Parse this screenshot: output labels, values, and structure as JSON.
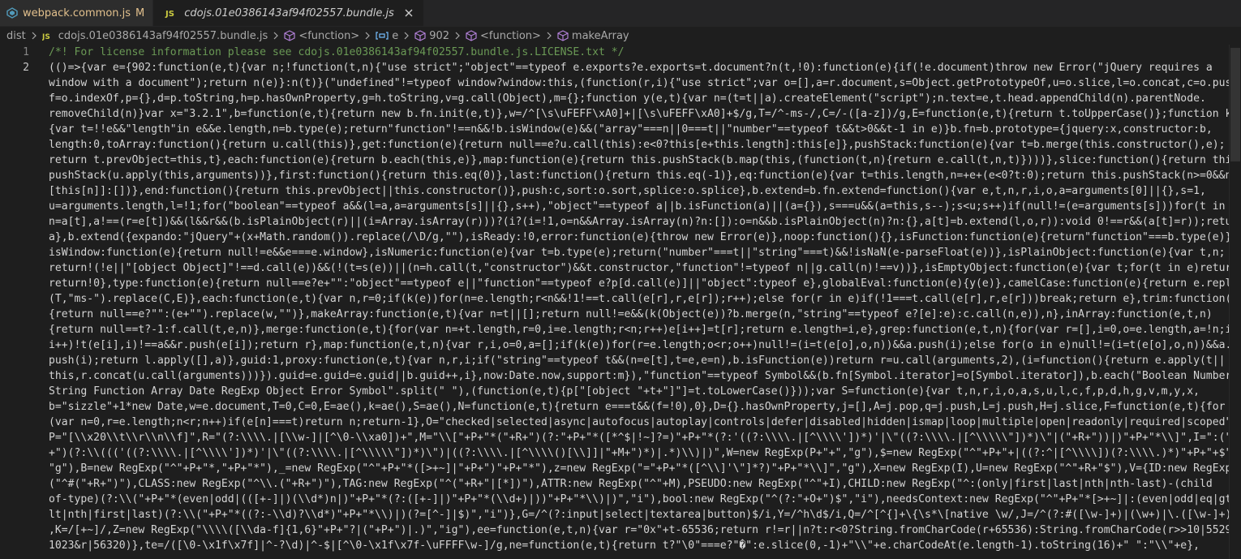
{
  "tabs": [
    {
      "label": "webpack.common.js",
      "badge": "M",
      "active": false
    },
    {
      "label": "cdojs.01e0386143af94f02557.bundle.js",
      "active": true
    }
  ],
  "breadcrumb": {
    "dist": "dist",
    "file": "cdojs.01e0386143af94f02557.bundle.js",
    "fn1": "<function>",
    "var": "e",
    "num": "902",
    "fn2": "<function>",
    "method": "makeArray"
  },
  "line_numbers": [
    "1",
    "2"
  ],
  "code_lines": [
    "/*! For license information please see cdojs.01e0386143af94f02557.bundle.js.LICENSE.txt */",
    "(()=>{var e={902:function(e,t){var n;!function(t,n){\"use strict\";\"object\"==typeof e.exports?e.exports=t.document?n(t,!0):function(e){if(!e.document)throw new Error(\"jQuery requires a",
    "window with a document\");return n(e)}:n(t)}(\"undefined\"!=typeof window?window:this,(function(r,i){\"use strict\";var o=[],a=r.document,s=Object.getPrototypeOf,u=o.slice,l=o.concat,c=o.push,",
    "f=o.indexOf,p={},d=p.toString,h=p.hasOwnProperty,g=h.toString,v=g.call(Object),m={};function y(e,t){var n=(t=t||a).createElement(\"script\");n.text=e,t.head.appendChild(n).parentNode.",
    "removeChild(n)}var x=\"3.2.1\",b=function(e,t){return new b.fn.init(e,t)},w=/^[\\s\\uFEFF\\xA0]+|[\\s\\uFEFF\\xA0]+$/g,T=/^-ms-/,C=/-([a-z])/g,E=function(e,t){return t.toUpperCase()};function k(e)",
    "{var t=!!e&&\"length\"in e&&e.length,n=b.type(e);return\"function\"!==n&&!b.isWindow(e)&&(\"array\"===n||0===t||\"number\"==typeof t&&t>0&&t-1 in e)}b.fn=b.prototype={jquery:x,constructor:b,",
    "length:0,toArray:function(){return u.call(this)},get:function(e){return null==e?u.call(this):e<0?this[e+this.length]:this[e]},pushStack:function(e){var t=b.merge(this.constructor(),e);",
    "return t.prevObject=this,t},each:function(e){return b.each(this,e)},map:function(e){return this.pushStack(b.map(this,(function(t,n){return e.call(t,n,t)})))},slice:function(){return this.",
    "pushStack(u.apply(this,arguments))},first:function(){return this.eq(0)},last:function(){return this.eq(-1)},eq:function(e){var t=this.length,n=+e+(e<0?t:0);return this.pushStack(n>=0&&n<t?",
    "[this[n]]:[])},end:function(){return this.prevObject||this.constructor()},push:c,sort:o.sort,splice:o.splice},b.extend=b.fn.extend=function(){var e,t,n,r,i,o,a=arguments[0]||{},s=1,",
    "u=arguments.length,l=!1;for(\"boolean\"==typeof a&&(l=a,a=arguments[s]||{},s++),\"object\"==typeof a||b.isFunction(a)||(a={}),s===u&&(a=this,s--);s<u;s++)if(null!=(e=arguments[s]))for(t in e)",
    "n=a[t],a!==(r=e[t])&&(l&&r&&(b.isPlainObject(r)||(i=Array.isArray(r)))?(i?(i=!1,o=n&&Array.isArray(n)?n:[]):o=n&&b.isPlainObject(n)?n:{},a[t]=b.extend(l,o,r)):void 0!==r&&(a[t]=r));return",
    "a},b.extend({expando:\"jQuery\"+(x+Math.random()).replace(/\\D/g,\"\"),isReady:!0,error:function(e){throw new Error(e)},noop:function(){},isFunction:function(e){return\"function\"===b.type(e)},",
    "isWindow:function(e){return null!=e&&e===e.window},isNumeric:function(e){var t=b.type(e);return(\"number\"===t||\"string\"===t)&&!isNaN(e-parseFloat(e))},isPlainObject:function(e){var t,n;",
    "return!(!e||\"[object Object]\"!==d.call(e))&&(!(t=s(e))||(n=h.call(t,\"constructor\")&&t.constructor,\"function\"!=typeof n||g.call(n)!==v))},isEmptyObject:function(e){var t;for(t in e)return!1;",
    "return!0},type:function(e){return null==e?e+\"\":\"object\"==typeof e||\"function\"==typeof e?p[d.call(e)]||\"object\":typeof e},globalEval:function(e){y(e)},camelCase:function(e){return e.replace",
    "(T,\"ms-\").replace(C,E)},each:function(e,t){var n,r=0;if(k(e))for(n=e.length;r<n&&!1!==t.call(e[r],r,e[r]);r++);else for(r in e)if(!1===t.call(e[r],r,e[r]))break;return e},trim:function(e)",
    "{return null==e?\"\":(e+\"\").replace(w,\"\")},makeArray:function(e,t){var n=t||[];return null!=e&&(k(Object(e))?b.merge(n,\"string\"==typeof e?[e]:e):c.call(n,e)),n},inArray:function(e,t,n)",
    "{return null==t?-1:f.call(t,e,n)},merge:function(e,t){for(var n=+t.length,r=0,i=e.length;r<n;r++)e[i++]=t[r];return e.length=i,e},grep:function(e,t,n){for(var r=[],i=0,o=e.length,a=!n;i<o;",
    "i++)!t(e[i],i)!==a&&r.push(e[i]);return r},map:function(e,t,n){var r,i,o=0,a=[];if(k(e))for(r=e.length;o<r;o++)null!=(i=t(e[o],o,n))&&a.push(i);else for(o in e)null!=(i=t(e[o],o,n))&&a.",
    "push(i);return l.apply([],a)},guid:1,proxy:function(e,t){var n,r,i;if(\"string\"==typeof t&&(n=e[t],t=e,e=n),b.isFunction(e))return r=u.call(arguments,2),(i=function(){return e.apply(t||",
    "this,r.concat(u.call(arguments)))}).guid=e.guid=e.guid||b.guid++,i},now:Date.now,support:m}),\"function\"==typeof Symbol&&(b.fn[Symbol.iterator]=o[Symbol.iterator]),b.each(\"Boolean Number",
    "String Function Array Date RegExp Object Error Symbol\".split(\" \"),(function(e,t){p[\"[object \"+t+\"]\"]=t.toLowerCase()}));var S=function(e){var t,n,r,i,o,a,s,u,l,c,f,p,d,h,g,v,m,y,x,",
    "b=\"sizzle\"+1*new Date,w=e.document,T=0,C=0,E=ae(),k=ae(),S=ae(),N=function(e,t){return e===t&&(f=!0),0},D={}.hasOwnProperty,j=[],A=j.pop,q=j.push,L=j.push,H=j.slice,F=function(e,t){for",
    "(var n=0,r=e.length;n<r;n++)if(e[n]===t)return n;return-1},O=\"checked|selected|async|autofocus|autoplay|controls|defer|disabled|hidden|ismap|loop|multiple|open|readonly|required|scoped\",",
    "P=\"[\\\\x20\\\\t\\\\r\\\\n\\\\f]\",R=\"(?:\\\\\\\\.|[\\\\w-]|[^\\0-\\\\xa0])+\",M=\"\\\\[\"+P+\"*(\"+R+\")(?:\"+P+\"*([*^$|!~]?=)\"+P+\"*(?:'((?:\\\\\\\\.|[^\\\\\\\\'])*)'|\\\"((?:\\\\\\\\.|[^\\\\\\\\\\\"])*)\\\"|(\"+R+\"))|)\"+P+\"*\\\\]\",I=\":(\"+R",
    "+\")(?:\\\\((('((?:\\\\\\\\.|[^\\\\\\\\'])*)'|\\\"((?:\\\\\\\\.|[^\\\\\\\\\\\"])*)\\\")|((?:\\\\\\\\.|[^\\\\\\\\()[\\\\]]|\"+M+\")*)|.*)\\\\)|)\",W=new RegExp(P+\"+\",\"g\"),$=new RegExp(\"^\"+P+\"+|((?:^|[^\\\\\\\\])(?:\\\\\\\\.)*)\"+P+\"+$\",",
    "\"g\"),B=new RegExp(\"^\"+P+\"*,\"+P+\"*\"),_=new RegExp(\"^\"+P+\"*([>+~]|\"+P+\")\"+P+\"*\"),z=new RegExp(\"=\"+P+\"*([^\\\\]'\\\"]*?)\"+P+\"*\\\\]\",\"g\"),X=new RegExp(I),U=new RegExp(\"^\"+R+\"$\"),V={ID:new RegExp",
    "(\"^#(\"+R+\")\"),CLASS:new RegExp(\"^\\\\.(\"+R+\")\"),TAG:new RegExp(\"^(\"+R+\"|[*])\"),ATTR:new RegExp(\"^\"+M),PSEUDO:new RegExp(\"^\"+I),CHILD:new RegExp(\"^:(only|first|last|nth|nth-last)-(child",
    "of-type)(?:\\\\(\"+P+\"*(even|odd|(([+-]|)(\\\\d*)n|)\"+P+\"*(?:([+-]|)\"+P+\"*(\\\\d+)|))\"+P+\"*\\\\)|)\",\"i\"),bool:new RegExp(\"^(?:\"+O+\")$\",\"i\"),needsContext:new RegExp(\"^\"+P+\"*[>+~]|:(even|odd|eq|gt|",
    "lt|nth|first|last)(?:\\\\(\"+P+\"*((?:-\\\\d)?\\\\d*)\"+P+\"*\\\\)|)(?=[^-]|$)\",\"i\")},G=/^(?:input|select|textarea|button)$/i,Y=/^h\\d$/i,Q=/^[^{]+\\{\\s*\\[native \\w/,J=/^(?:#([\\w-]+)|(\\w+)|\\.([\\w-]+))$/",
    ",K=/[+~]/,Z=new RegExp(\"\\\\\\\\([\\\\da-f]{1,6}\"+P+\"?|(\"+P+\")|.)\",\"ig\"),ee=function(e,t,n){var r=\"0x\"+t-65536;return r!=r||n?t:r<0?String.fromCharCode(r+65536):String.fromCharCode(r>>10|55296,",
    "1023&r|56320)},te=/([\\0-\\x1f\\x7f]|^-?\\d)|^-$|[^\\0-\\x1f\\x7f-\\uFFFF\\w-]/g,ne=function(e,t){return t?\"\\0\"===e?\"�\":e.slice(0,-1)+\"\\\\\"+e.charCodeAt(e.length-1).toString(16)+\" \":\"\\\\\"+e},"
  ],
  "colors": {
    "background": "#1e1e1e",
    "tab_bar": "#252526",
    "comment": "#6a9955",
    "text": "#d4d4d4",
    "line_number": "#858585",
    "modified": "#e2c08d",
    "js_icon": "#cbcb41",
    "webpack_icon": "#519aba",
    "symbol_icon": "#b180d7",
    "variable_icon": "#75beff"
  }
}
